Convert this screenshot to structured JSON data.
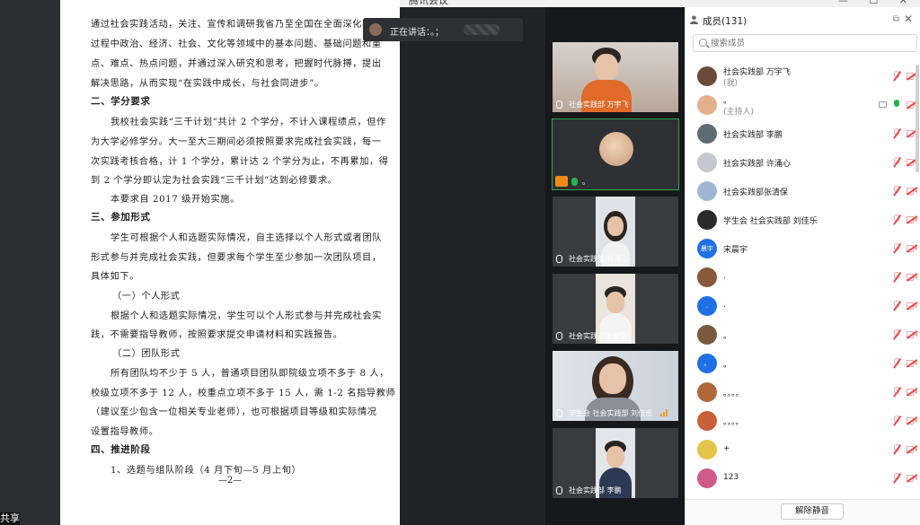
{
  "window": {
    "title": "腾讯会议"
  },
  "share_label": "共享",
  "document": {
    "lines": [
      "通过社会实践活动，关注、宣传和调研我省乃至全国在全面深化改",
      "过程中政治、经济、社会、文化等领域中的基本问题、基础问题和重",
      "点、难点、热点问题，并通过深入研究和思考，把握时代脉搏，提出",
      "解决思路，从而实现“在实践中成长，与社会同进步”。",
      "二、学分要求",
      "我校社会实践“三千计划”共计 2 个学分，不计入课程绩点，但作",
      "为大学必修学分。大一至大三期间必须按照要求完成社会实践，每一",
      "次实践考核合格，计 1 个学分，累计达 2 个学分为止，不再累加，得",
      "到 2 个学分即认定为社会实践“三千计划”达到必修要求。",
      "本要求自 2017 级开始实施。",
      "三、参加形式",
      "学生可根据个人和选题实际情况，自主选择以个人形式或者团队",
      "形式参与并完成社会实践，但要求每个学生至少参加一次团队项目，",
      "具体如下。",
      "（一）个人形式",
      "根据个人和选题实际情况，学生可以个人形式参与并完成社会实",
      "践，不需要指导教师，按照要求提交申请材料和实践报告。",
      "（二）团队形式",
      "所有团队均不少于 5 人，普通项目团队即院级立项不多于 8 人，",
      "校级立项不多于 12 人，校重点立项不多于 15 人，需 1-2 名指导教师",
      "（建议至少包含一位相关专业老师），也可根据项目等级和实际情况",
      "设置指导教师。",
      "四、推进阶段",
      "1、选题与组队阶段（4 月下旬—5 月上旬）"
    ],
    "page_number": "—2—"
  },
  "speaking": {
    "label": "正在讲话：。；"
  },
  "videos": [
    {
      "name": "社会实践部  万宇飞"
    },
    {
      "name": "。"
    },
    {
      "name": "社会实践部 许涌心"
    },
    {
      "name": "社会实践部张清保"
    },
    {
      "name": "学生会 社会实践部 刘佳乐"
    },
    {
      "name": "社会实践部 李鹏"
    }
  ],
  "members_panel": {
    "title": "成员(131)",
    "search_placeholder": "搜索成员",
    "unmute_all_label": "解除静音",
    "members": [
      {
        "name": "社会实践部  万宇飞",
        "sub": "(我)",
        "mic": "muted",
        "avatar_color": "#6b4a3a"
      },
      {
        "name": "。",
        "sub": "(主持人)",
        "mic": "on",
        "avatar_color": "#e3b08c"
      },
      {
        "name": "社会实践部 李鹏",
        "sub": "",
        "mic": "muted",
        "avatar_color": "#5d6d73"
      },
      {
        "name": "社会实践部 许涌心",
        "sub": "",
        "mic": "muted",
        "avatar_color": "#c7c7cf"
      },
      {
        "name": "社会实践部张清保",
        "sub": "",
        "mic": "muted",
        "avatar_color": "#9fb6d6"
      },
      {
        "name": "学生会 社会实践部 刘佳乐",
        "sub": "",
        "mic": "muted",
        "avatar_color": "#2a2a2a"
      },
      {
        "name": "宋晨宇",
        "sub": "",
        "mic": "muted",
        "avatar_color": "#1f6fe5",
        "avatar_text": "晨宇"
      },
      {
        "name": ".",
        "sub": "",
        "mic": "muted",
        "avatar_color": "#8a5a3a"
      },
      {
        "name": ".",
        "sub": "",
        "mic": "muted",
        "avatar_color": "#1f6fe5",
        "avatar_text": "."
      },
      {
        "name": "。",
        "sub": "",
        "mic": "muted",
        "avatar_color": "#7a5b3f"
      },
      {
        "name": "。",
        "sub": "",
        "mic": "muted",
        "avatar_color": "#1f6fe5",
        "avatar_text": "。"
      },
      {
        "name": "。。。。",
        "sub": "",
        "mic": "muted",
        "avatar_color": "#b0683a"
      },
      {
        "name": "。。。。",
        "sub": "",
        "mic": "muted",
        "avatar_color": "#c8603a"
      },
      {
        "name": "+",
        "sub": "",
        "mic": "muted",
        "avatar_color": "#e5c44a"
      },
      {
        "name": "123",
        "sub": "",
        "mic": "muted",
        "avatar_color": "#d05a8a"
      }
    ]
  }
}
